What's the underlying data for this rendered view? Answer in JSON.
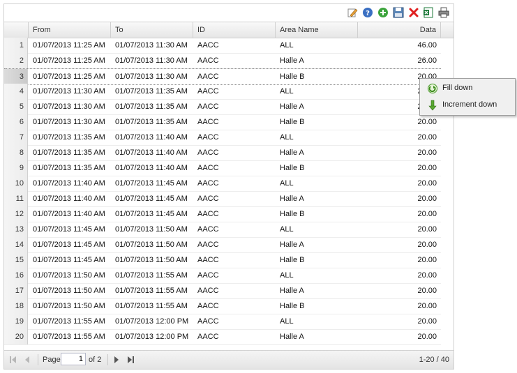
{
  "toolbar": {
    "buttons": [
      {
        "name": "edit-icon",
        "color": "#e8a33a"
      },
      {
        "name": "help-icon",
        "color": "#3a6fc2"
      },
      {
        "name": "add-icon",
        "color": "#3ca43c"
      },
      {
        "name": "save-icon",
        "color": "#5b86b8"
      },
      {
        "name": "delete-icon",
        "color": "#e02020"
      },
      {
        "name": "excel-export-icon",
        "color": "#1d7a3a"
      },
      {
        "name": "print-icon",
        "color": "#555555"
      }
    ]
  },
  "columns": [
    "From",
    "To",
    "ID",
    "Area Name",
    "Data"
  ],
  "rows": [
    {
      "n": "1",
      "from": "01/07/2013 11:25 AM",
      "to": "01/07/2013 11:30 AM",
      "id": "AACC",
      "area": "ALL",
      "data": "46.00"
    },
    {
      "n": "2",
      "from": "01/07/2013 11:25 AM",
      "to": "01/07/2013 11:30 AM",
      "id": "AACC",
      "area": "Halle A",
      "data": "26.00"
    },
    {
      "n": "3",
      "from": "01/07/2013 11:25 AM",
      "to": "01/07/2013 11:30 AM",
      "id": "AACC",
      "area": "Halle B",
      "data": "20.00"
    },
    {
      "n": "4",
      "from": "01/07/2013 11:30 AM",
      "to": "01/07/2013 11:35 AM",
      "id": "AACC",
      "area": "ALL",
      "data": "20.00"
    },
    {
      "n": "5",
      "from": "01/07/2013 11:30 AM",
      "to": "01/07/2013 11:35 AM",
      "id": "AACC",
      "area": "Halle A",
      "data": "20.00"
    },
    {
      "n": "6",
      "from": "01/07/2013 11:30 AM",
      "to": "01/07/2013 11:35 AM",
      "id": "AACC",
      "area": "Halle B",
      "data": "20.00"
    },
    {
      "n": "7",
      "from": "01/07/2013 11:35 AM",
      "to": "01/07/2013 11:40 AM",
      "id": "AACC",
      "area": "ALL",
      "data": "20.00"
    },
    {
      "n": "8",
      "from": "01/07/2013 11:35 AM",
      "to": "01/07/2013 11:40 AM",
      "id": "AACC",
      "area": "Halle A",
      "data": "20.00"
    },
    {
      "n": "9",
      "from": "01/07/2013 11:35 AM",
      "to": "01/07/2013 11:40 AM",
      "id": "AACC",
      "area": "Halle B",
      "data": "20.00"
    },
    {
      "n": "10",
      "from": "01/07/2013 11:40 AM",
      "to": "01/07/2013 11:45 AM",
      "id": "AACC",
      "area": "ALL",
      "data": "20.00"
    },
    {
      "n": "11",
      "from": "01/07/2013 11:40 AM",
      "to": "01/07/2013 11:45 AM",
      "id": "AACC",
      "area": "Halle A",
      "data": "20.00"
    },
    {
      "n": "12",
      "from": "01/07/2013 11:40 AM",
      "to": "01/07/2013 11:45 AM",
      "id": "AACC",
      "area": "Halle B",
      "data": "20.00"
    },
    {
      "n": "13",
      "from": "01/07/2013 11:45 AM",
      "to": "01/07/2013 11:50 AM",
      "id": "AACC",
      "area": "ALL",
      "data": "20.00"
    },
    {
      "n": "14",
      "from": "01/07/2013 11:45 AM",
      "to": "01/07/2013 11:50 AM",
      "id": "AACC",
      "area": "Halle A",
      "data": "20.00"
    },
    {
      "n": "15",
      "from": "01/07/2013 11:45 AM",
      "to": "01/07/2013 11:50 AM",
      "id": "AACC",
      "area": "Halle B",
      "data": "20.00"
    },
    {
      "n": "16",
      "from": "01/07/2013 11:50 AM",
      "to": "01/07/2013 11:55 AM",
      "id": "AACC",
      "area": "ALL",
      "data": "20.00"
    },
    {
      "n": "17",
      "from": "01/07/2013 11:50 AM",
      "to": "01/07/2013 11:55 AM",
      "id": "AACC",
      "area": "Halle A",
      "data": "20.00"
    },
    {
      "n": "18",
      "from": "01/07/2013 11:50 AM",
      "to": "01/07/2013 11:55 AM",
      "id": "AACC",
      "area": "Halle B",
      "data": "20.00"
    },
    {
      "n": "19",
      "from": "01/07/2013 11:55 AM",
      "to": "01/07/2013 12:00 PM",
      "id": "AACC",
      "area": "ALL",
      "data": "20.00"
    },
    {
      "n": "20",
      "from": "01/07/2013 11:55 AM",
      "to": "01/07/2013 12:00 PM",
      "id": "AACC",
      "area": "Halle A",
      "data": "20.00"
    }
  ],
  "selected_row": "3",
  "pager": {
    "page_label": "Page",
    "page_value": "1",
    "of_label": "of 2",
    "range_label": "1-20 / 40"
  },
  "context_menu": {
    "items": [
      {
        "label": "Fill down",
        "icon": "fill-down-icon"
      },
      {
        "label": "Increment down",
        "icon": "increment-down-icon"
      }
    ]
  }
}
